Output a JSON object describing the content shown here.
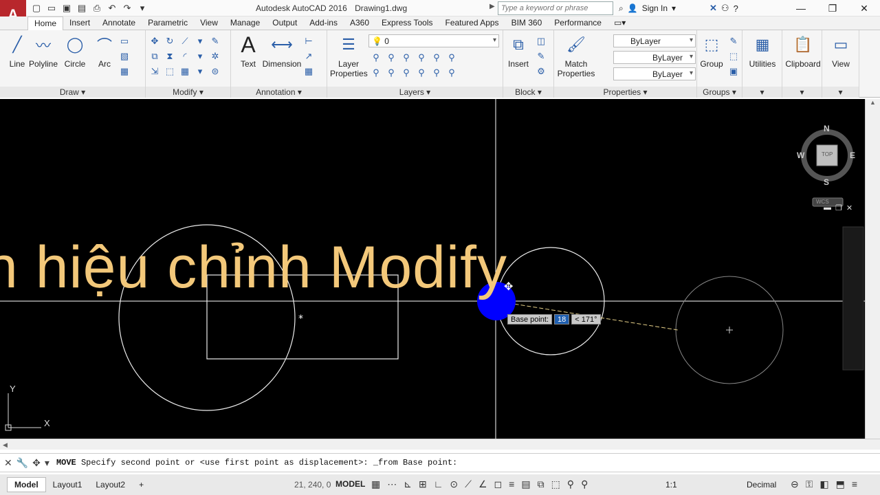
{
  "title": {
    "app": "Autodesk AutoCAD 2016",
    "file": "Drawing1.dwg"
  },
  "search": {
    "placeholder": "Type a keyword or phrase"
  },
  "account": {
    "signin": "Sign In"
  },
  "tabs": [
    "Home",
    "Insert",
    "Annotate",
    "Parametric",
    "View",
    "Manage",
    "Output",
    "Add-ins",
    "A360",
    "Express Tools",
    "Featured Apps",
    "BIM 360",
    "Performance"
  ],
  "ribbon": {
    "draw": {
      "title": "Draw",
      "line": "Line",
      "polyline": "Polyline",
      "circle": "Circle",
      "arc": "Arc"
    },
    "modify": {
      "title": "Modify"
    },
    "annotation": {
      "title": "Annotation",
      "text": "Text",
      "dimension": "Dimension"
    },
    "layers": {
      "title": "Layers",
      "layer_properties": "Layer Properties",
      "current_layer": "0"
    },
    "block": {
      "title": "Block",
      "insert": "Insert"
    },
    "properties": {
      "title": "Properties",
      "match": "Match Properties",
      "color": "ByLayer",
      "linetype": "ByLayer",
      "lineweight": "ByLayer"
    },
    "groups": {
      "title": "Groups",
      "group": "Group"
    },
    "utilities": "Utilities",
    "clipboard": "Clipboard",
    "view": "View"
  },
  "canvas": {
    "overlay_title": "n hiệu chỉnh Modify",
    "viewcube": {
      "n": "N",
      "s": "S",
      "e": "E",
      "w": "W",
      "top": "TOP",
      "wcs": "WCS"
    },
    "ucs": {
      "x": "X",
      "y": "Y"
    },
    "dyn_input": {
      "label": "Base point:",
      "value": "18",
      "angle": "< 171°"
    }
  },
  "command": {
    "keyword": "MOVE",
    "text": "Specify second point or <use first point as displacement>: _from Base point:"
  },
  "status": {
    "layouts": [
      "Model",
      "Layout1",
      "Layout2"
    ],
    "coords": "21, 240, 0",
    "space": "MODEL",
    "scale": "1:1",
    "units": "Decimal"
  },
  "colors": {
    "canvas": "#000000",
    "overlay": "#f3c87a",
    "grip": "#0000ff",
    "accent": "#b8272c"
  }
}
